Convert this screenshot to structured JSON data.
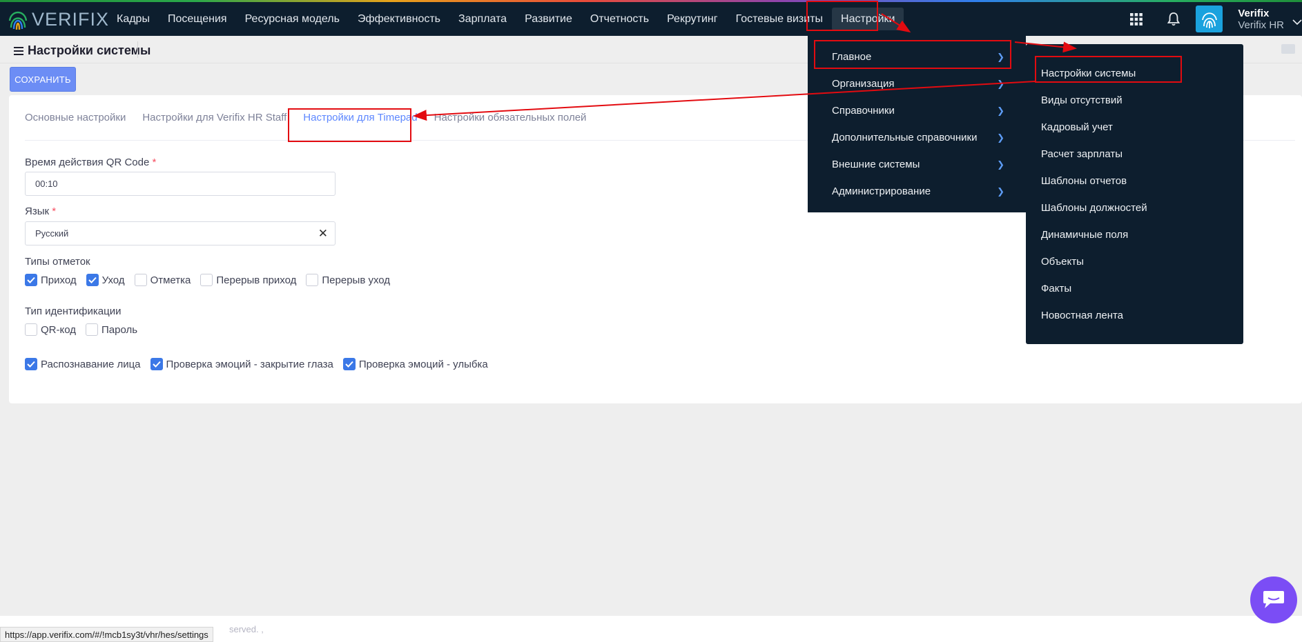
{
  "app": {
    "logo_text": "VERIFIX",
    "nav": [
      {
        "label": "Кадры"
      },
      {
        "label": "Посещения"
      },
      {
        "label": "Ресурсная модель"
      },
      {
        "label": "Эффективность"
      },
      {
        "label": "Зарплата"
      },
      {
        "label": "Развитие"
      },
      {
        "label": "Отчетность"
      },
      {
        "label": "Рекрутинг"
      },
      {
        "label": "Гостевые визиты"
      },
      {
        "label": "Настройки"
      }
    ],
    "user": {
      "name": "Verifix",
      "company": "Verifix HR"
    },
    "icons": {
      "apps": "grid-icon",
      "notifications": "bell-icon",
      "avatar": "fingerprint-icon"
    }
  },
  "page": {
    "title": "Настройки системы",
    "save_label": "СОХРАНИТЬ"
  },
  "tabs": [
    {
      "label": "Основные настройки"
    },
    {
      "label": "Настройки для Verifix HR Staff"
    },
    {
      "label": "Настройки для Timepad"
    },
    {
      "label": "Настройки обязательных полей"
    }
  ],
  "form": {
    "qr_label": "Время действия QR Code",
    "qr_value": "00:10",
    "lang_label": "Язык",
    "lang_value": "Русский",
    "required_mark": "*",
    "mark_types_label": "Типы отметок",
    "mark_types": [
      {
        "label": "Приход",
        "checked": true
      },
      {
        "label": "Уход",
        "checked": true
      },
      {
        "label": "Отметка",
        "checked": false
      },
      {
        "label": "Перерыв приход",
        "checked": false
      },
      {
        "label": "Перерыв уход",
        "checked": false
      }
    ],
    "ident_label": "Тип идентификации",
    "ident_types": [
      {
        "label": "QR-код",
        "checked": false
      },
      {
        "label": "Пароль",
        "checked": false
      }
    ],
    "extra_options": [
      {
        "label": "Распознавание лица",
        "checked": true
      },
      {
        "label": "Проверка эмоций - закрытие глаза",
        "checked": true
      },
      {
        "label": "Проверка эмоций - улыбка",
        "checked": true
      }
    ]
  },
  "settings_menu": {
    "items": [
      {
        "label": "Главное"
      },
      {
        "label": "Организация"
      },
      {
        "label": "Справочники"
      },
      {
        "label": "Дополнительные справочники"
      },
      {
        "label": "Внешние системы"
      },
      {
        "label": "Администрирование"
      }
    ],
    "submenu": [
      {
        "label": "Настройки системы"
      },
      {
        "label": "Виды отсутствий"
      },
      {
        "label": "Кадровый учет"
      },
      {
        "label": "Расчет зарплаты"
      },
      {
        "label": "Шаблоны отчетов"
      },
      {
        "label": "Шаблоны должностей"
      },
      {
        "label": "Динамичные поля"
      },
      {
        "label": "Объекты"
      },
      {
        "label": "Факты"
      },
      {
        "label": "Новостная лента"
      }
    ]
  },
  "footer": {
    "copyright": "served. ,",
    "status_url": "https://app.verifix.com/#/!mcb1sy3t/vhr/hes/settings"
  },
  "colors": {
    "topbar": "#0d1e2e",
    "accent": "#5d87ff",
    "checkbox": "#3b78e7",
    "highlight": "#e30b10",
    "chat": "#7b4df5"
  }
}
